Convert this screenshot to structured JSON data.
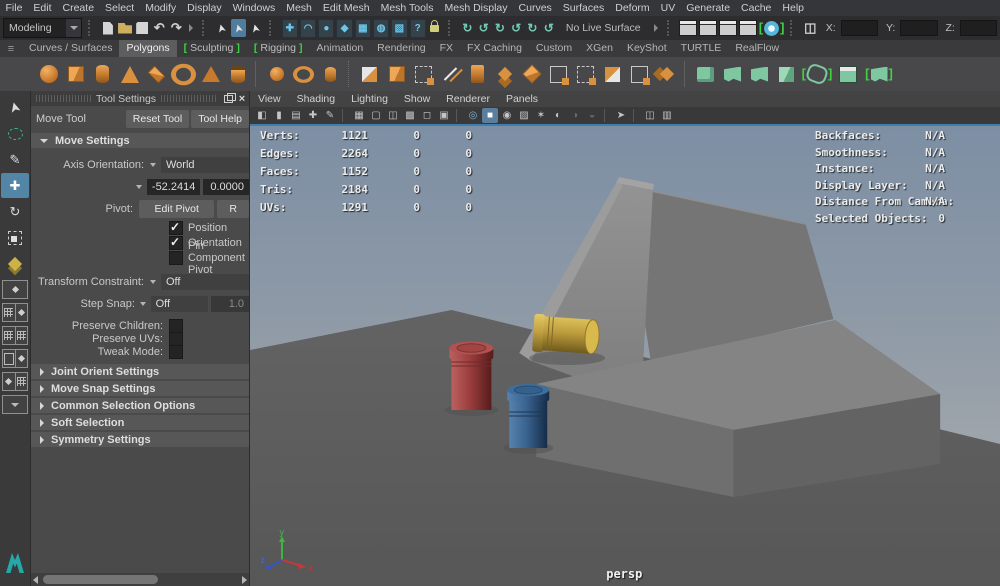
{
  "menu_bar": {
    "items": [
      "File",
      "Edit",
      "Create",
      "Select",
      "Modify",
      "Display",
      "Windows",
      "Mesh",
      "Edit Mesh",
      "Mesh Tools",
      "Mesh Display",
      "Curves",
      "Surfaces",
      "Deform",
      "UV",
      "Generate",
      "Cache",
      "Help"
    ]
  },
  "status_line": {
    "menuset": "Modeling",
    "undo_glyph": "↶",
    "redo_glyph": "↷",
    "select_cursor_glyph": "➤",
    "no_live_surface_label": "No Live Surface",
    "snap_icons": [
      {
        "name": "snap-grid",
        "g": "✚"
      },
      {
        "name": "snap-curve",
        "g": "◠"
      },
      {
        "name": "snap-point",
        "g": "●"
      },
      {
        "name": "snap-projected-center",
        "g": "◆"
      },
      {
        "name": "make-live",
        "g": "▦"
      },
      {
        "name": "snap-together",
        "g": "◍"
      },
      {
        "name": "soft-select",
        "g": "▧"
      },
      {
        "name": "quick-help",
        "g": "?"
      }
    ],
    "history_icons": [
      {
        "name": "input-connections",
        "g": "↻"
      },
      {
        "name": "output-connections",
        "g": "↺"
      },
      {
        "name": "construction-history-on",
        "g": "↻"
      },
      {
        "name": "construction-history-off",
        "g": "↺"
      },
      {
        "name": "list-inputs",
        "g": "↻"
      },
      {
        "name": "list-outputs",
        "g": "↺"
      }
    ],
    "layout_glyph": "◫",
    "coord_x_label": "X:",
    "coord_y_label": "Y:",
    "coord_z_label": "Z:",
    "coord_x_value": "",
    "coord_y_value": "",
    "coord_z_value": ""
  },
  "shelf": {
    "tabs": [
      "Curves / Surfaces",
      "Polygons",
      "Sculpting",
      "Rigging",
      "Animation",
      "Rendering",
      "FX",
      "FX Caching",
      "Custom",
      "XGen",
      "KeyShot",
      "TURTLE",
      "RealFlow"
    ],
    "active_tab": "Polygons"
  },
  "tool_settings": {
    "title": "Tool Settings",
    "close_glyph": "×",
    "tool_name": "Move Tool",
    "reset_button": "Reset Tool",
    "help_button": "Tool Help",
    "move_settings_header": "Move Settings",
    "axis_orientation_label": "Axis Orientation:",
    "axis_orientation_value": "World",
    "value_field_1": "-52.2414",
    "value_field_2": "0.0000",
    "pivot_label": "Pivot:",
    "edit_pivot_button": "Edit Pivot",
    "reset_pivot_button_clipped": "R",
    "checkbox_position": "Position",
    "checkbox_orientation": "Orientation",
    "checkbox_pin": "Pin Component Pivot",
    "transform_constraint_label": "Transform Constraint:",
    "transform_constraint_value": "Off",
    "step_snap_label": "Step Snap:",
    "step_snap_value": "Off",
    "step_snap_size": "1.0",
    "preserve_children_label": "Preserve Children:",
    "preserve_uvs_label": "Preserve UVs:",
    "tweak_mode_label": "Tweak Mode:",
    "collapsed_sections": [
      "Joint Orient Settings",
      "Move Snap Settings",
      "Common Selection Options",
      "Soft Selection",
      "Symmetry Settings"
    ]
  },
  "viewport": {
    "menus": [
      "View",
      "Shading",
      "Lighting",
      "Show",
      "Renderer",
      "Panels"
    ],
    "vp_icons": [
      {
        "name": "camera",
        "g": "◧"
      },
      {
        "name": "bookmark",
        "g": "▮"
      },
      {
        "name": "image-plane",
        "g": "▤"
      },
      {
        "name": "pan-zoom",
        "g": "✚"
      },
      {
        "name": "grease-pencil",
        "g": "✎"
      },
      {
        "name": "grid",
        "g": "▦"
      },
      {
        "name": "film-gate",
        "g": "▢"
      },
      {
        "name": "resolution-gate",
        "g": "◫"
      },
      {
        "name": "gate-mask",
        "g": "▩"
      },
      {
        "name": "display-region",
        "g": "◻"
      },
      {
        "name": "letterbox",
        "g": "▣"
      },
      {
        "name": "wireframe",
        "g": "◎"
      },
      {
        "name": "shaded",
        "g": "■"
      },
      {
        "name": "wireframe-on-shaded",
        "g": "◉"
      },
      {
        "name": "textured",
        "g": "▨"
      },
      {
        "name": "lights",
        "g": "✶"
      },
      {
        "name": "shadows",
        "g": "◐"
      },
      {
        "name": "screen-ao",
        "g": "◑"
      },
      {
        "name": "motion-blur",
        "g": "◒"
      },
      {
        "name": "isolate-select",
        "g": "➤"
      },
      {
        "name": "pane-layout",
        "g": "◫"
      },
      {
        "name": "xray",
        "g": "▥"
      }
    ],
    "hud": {
      "poly_count": {
        "rows": [
          {
            "label": "Verts:",
            "total": "1121",
            "selected": "0",
            "other": "0"
          },
          {
            "label": "Edges:",
            "total": "2264",
            "selected": "0",
            "other": "0"
          },
          {
            "label": "Faces:",
            "total": "1152",
            "selected": "0",
            "other": "0"
          },
          {
            "label": "Tris:",
            "total": "2184",
            "selected": "0",
            "other": "0"
          },
          {
            "label": "UVs:",
            "total": "1291",
            "selected": "0",
            "other": "0"
          }
        ]
      },
      "object_details": {
        "rows": [
          {
            "label": "Backfaces:",
            "value": "N/A"
          },
          {
            "label": "Smoothness:",
            "value": "N/A"
          },
          {
            "label": "Instance:",
            "value": "N/A"
          },
          {
            "label": "Display Layer:",
            "value": "N/A"
          },
          {
            "label": "Distance From Camera:",
            "value": "N/A"
          },
          {
            "label": "Selected Objects:",
            "value": "0"
          }
        ]
      }
    },
    "axis": {
      "x": "x",
      "y": "y",
      "z": "z"
    },
    "camera_label": "persp"
  },
  "colors": {
    "accent_blue": "#5285a6",
    "active_border_blue": "#3f7fae",
    "shelf_orange": "#d9913f",
    "shelf_green": "#7fc7a1",
    "bracket_green": "#3fd23f",
    "sky_top": "#7d8fa4",
    "ground_gray": "#5e5e5e",
    "cylinder_yellow": "#bb9a3c",
    "cylinder_red": "#9d3e3e",
    "cylinder_blue": "#3a6390"
  }
}
